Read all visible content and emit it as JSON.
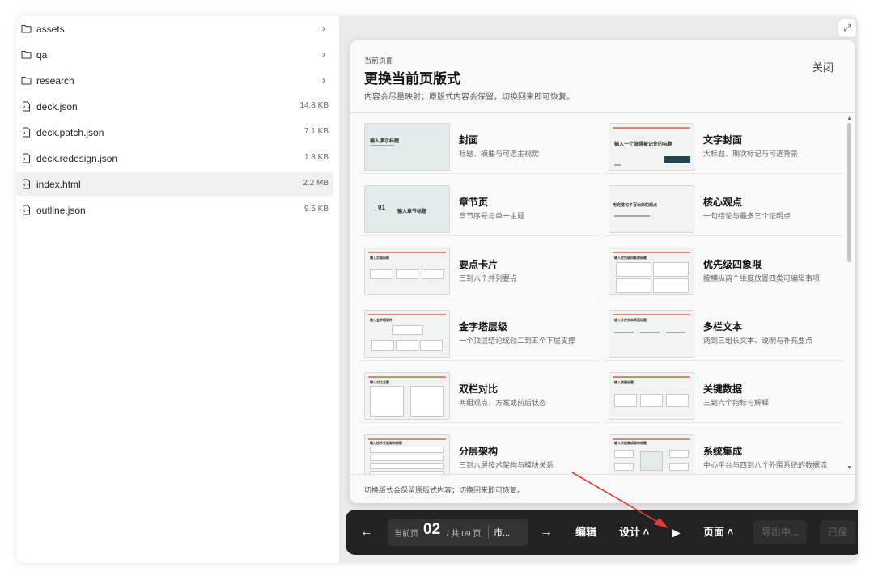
{
  "files": [
    {
      "name": "assets",
      "type": "folder"
    },
    {
      "name": "qa",
      "type": "folder"
    },
    {
      "name": "research",
      "type": "folder"
    },
    {
      "name": "deck.json",
      "type": "file",
      "size": "14.8 KB"
    },
    {
      "name": "deck.patch.json",
      "type": "file",
      "size": "7.1 KB"
    },
    {
      "name": "deck.redesign.json",
      "type": "file",
      "size": "1.8 KB"
    },
    {
      "name": "index.html",
      "type": "file",
      "size": "2.2 MB",
      "selected": true
    },
    {
      "name": "outline.json",
      "type": "file",
      "size": "9.5 KB"
    }
  ],
  "modal": {
    "subtitle": "当前页面",
    "title": "更换当前页版式",
    "description": "内容会尽量映射；原版式内容会保留，切换回来即可恢复。",
    "close_label": "关闭",
    "footer": "切换版式会保留原版式内容；切换回来即可恢复。",
    "layouts": [
      {
        "title": "封面",
        "desc": "标题、摘要与可选主视觉",
        "thumb_text": "输入演示标题"
      },
      {
        "title": "文字封面",
        "desc": "大标题、期次标记与可选背景",
        "thumb_text": "输入一个值得被记住的标题"
      },
      {
        "title": "章节页",
        "desc": "章节序号与单一主题",
        "thumb_num": "01",
        "thumb_text": "输入章节标题"
      },
      {
        "title": "核心观点",
        "desc": "一句结论与最多三个证明点",
        "thumb_text": "用完整句子写出你的观点"
      },
      {
        "title": "要点卡片",
        "desc": "三到六个并列要点",
        "thumb_text": "输入页面标题"
      },
      {
        "title": "优先级四象限",
        "desc": "按横纵两个维度放置四类可编辑事项",
        "thumb_text": "输入优先级四象限标题"
      },
      {
        "title": "金字塔层级",
        "desc": "一个顶层结论统领二到五个下层支撑",
        "thumb_text": "输入金字塔架构"
      },
      {
        "title": "多栏文本",
        "desc": "两到三组长文本、说明与补充要点",
        "thumb_text": "输入多栏文本页面标题"
      },
      {
        "title": "双栏对比",
        "desc": "两组观点、方案或前后状态",
        "thumb_text": "输入对比主题"
      },
      {
        "title": "关键数据",
        "desc": "三到六个指标与解释",
        "thumb_text": "输入数据标题"
      },
      {
        "title": "分层架构",
        "desc": "三到六层技术架构与模块关系",
        "thumb_text": "输入技术分层架构标题"
      },
      {
        "title": "系统集成",
        "desc": "中心平台与四到八个外围系统的数据流",
        "thumb_text": "输入系统集成架构标题"
      }
    ]
  },
  "toolbar": {
    "prev_arrow": "←",
    "page_label": "当前页",
    "page_number": "02",
    "page_total": "/ 共 09 页",
    "page_section": "市...",
    "next_arrow": "→",
    "edit_label": "编辑",
    "design_label": "设计 ˄",
    "play_icon": "▶",
    "page_menu_label": "页面 ˄",
    "export_label": "导出中...",
    "saved_label": "已保"
  },
  "colors": {
    "toolbar_bg": "#222222",
    "pointer": "#e53935",
    "selected_row": "#f0f0f0"
  }
}
